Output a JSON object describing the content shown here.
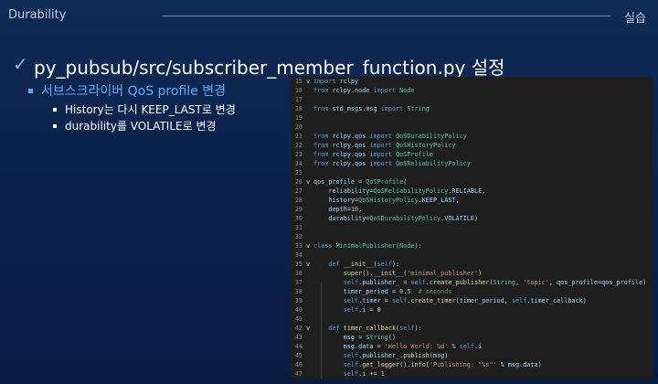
{
  "header": {
    "left": "Durability",
    "right": "실습"
  },
  "slide": {
    "check": "✓",
    "title": "py_pubsub/src/subscriber_member_function.py 설정",
    "bullet1": "서브스크라이버 QoS profile 변경",
    "bullet2": "History는 다시 KEEP_LAST로 변경",
    "bullet3": "durability를 VOLATILE로 변경"
  },
  "editor": {
    "lines": [
      {
        "n": "15",
        "fold": "v",
        "t": "import rclpy"
      },
      {
        "n": "16",
        "fold": "",
        "t": "from rclpy.node import Node"
      },
      {
        "n": "17",
        "fold": "",
        "t": ""
      },
      {
        "n": "18",
        "fold": "",
        "t": "from std_msgs.msg import String"
      },
      {
        "n": "19",
        "fold": "",
        "t": ""
      },
      {
        "n": "20",
        "fold": "",
        "t": ""
      },
      {
        "n": "21",
        "fold": "",
        "t": "from rclpy.qos import QoSDurabilityPolicy"
      },
      {
        "n": "22",
        "fold": "",
        "t": "from rclpy.qos import QoSHistoryPolicy"
      },
      {
        "n": "23",
        "fold": "",
        "t": "from rclpy.qos import QoSProfile"
      },
      {
        "n": "24",
        "fold": "",
        "t": "from rclpy.qos import QoSReliabilityPolicy"
      },
      {
        "n": "25",
        "fold": "",
        "t": ""
      },
      {
        "n": "26",
        "fold": "v",
        "t": "qos_profile = QoSProfile("
      },
      {
        "n": "27",
        "fold": "",
        "t": "    reliability=QoSReliabilityPolicy.RELIABLE,"
      },
      {
        "n": "28",
        "fold": "",
        "t": "    history=QoSHistoryPolicy.KEEP_LAST,"
      },
      {
        "n": "29",
        "fold": "",
        "t": "    depth=10,"
      },
      {
        "n": "30",
        "fold": "",
        "t": "    durability=QoSDurabilityPolicy.VOLATILE)"
      },
      {
        "n": "31",
        "fold": "",
        "t": ""
      },
      {
        "n": "32",
        "fold": "",
        "t": ""
      },
      {
        "n": "33",
        "fold": "v",
        "t": "class MinimalPublisher(Node):"
      },
      {
        "n": "34",
        "fold": "",
        "t": ""
      },
      {
        "n": "35",
        "fold": "v",
        "t": "    def __init__(self):"
      },
      {
        "n": "36",
        "fold": "",
        "t": "        super().__init__('minimal_publisher')"
      },
      {
        "n": "37",
        "fold": "",
        "t": "        self.publisher_ = self.create_publisher(String, 'topic', qos_profile=qos_profile)"
      },
      {
        "n": "38",
        "fold": "",
        "t": "        timer_period = 0.5  # seconds"
      },
      {
        "n": "39",
        "fold": "",
        "t": "        self.timer = self.create_timer(timer_period, self.timer_callback)"
      },
      {
        "n": "40",
        "fold": "",
        "t": "        self.i = 0"
      },
      {
        "n": "41",
        "fold": "",
        "t": ""
      },
      {
        "n": "42",
        "fold": "v",
        "t": "    def timer_callback(self):"
      },
      {
        "n": "43",
        "fold": "",
        "t": "        msg = String()"
      },
      {
        "n": "44",
        "fold": "",
        "t": "        msg.data = 'Hello World: %d' % self.i"
      },
      {
        "n": "45",
        "fold": "",
        "t": "        self.publisher_.publish(msg)"
      },
      {
        "n": "46",
        "fold": "",
        "t": "        self.get_logger().info('Publishing: \"%s\"' % msg.data)"
      },
      {
        "n": "47",
        "fold": "",
        "t": "        self.i += 1"
      }
    ]
  },
  "colors": {
    "background": "#0f2a55",
    "accent": "#54b0ff",
    "editor_bg": "#1e1e1e"
  }
}
